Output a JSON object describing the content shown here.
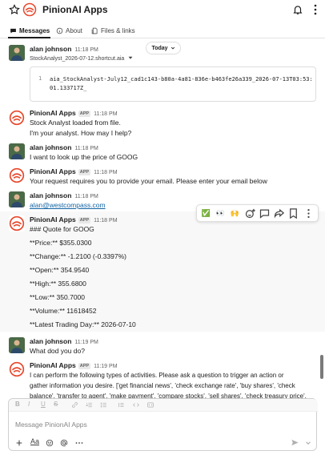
{
  "app": {
    "title": "PinionAI Apps"
  },
  "tabs": [
    {
      "label": "Messages"
    },
    {
      "label": "About"
    },
    {
      "label": "Files & links"
    }
  ],
  "date_pill": "Today",
  "messages": [
    {
      "sender": "alan johnson",
      "time": "11:18 PM",
      "file_name": "StockAnalyst_2026-07-12.shortcut.aia",
      "code_line_no": "1",
      "code": "aia_StockAnalyst-July12_cad1c143-b80a-4a81-836e-b463fe26a339_2026-07-13T03:53:01.133717Z_"
    },
    {
      "sender": "PinionAI Apps",
      "badge": "APP",
      "time": "11:18 PM",
      "lines": [
        "Stock Analyst loaded from file.",
        "I'm your analyst. How may I help?"
      ]
    },
    {
      "sender": "alan johnson",
      "time": "11:18 PM",
      "lines": [
        "I want to look up the price of GOOG"
      ]
    },
    {
      "sender": "PinionAI Apps",
      "badge": "APP",
      "time": "11:18 PM",
      "lines": [
        "Your request requires you to provide your email. Please enter your email below"
      ]
    },
    {
      "sender": "alan johnson",
      "time": "11:18 PM",
      "link": "alan@westcompass.com"
    },
    {
      "sender": "PinionAI Apps",
      "badge": "APP",
      "time": "11:18 PM",
      "lines": [
        "### Quote for GOOG",
        "**Price:** $355.0300",
        "**Change:** -1.2100 (-0.3397%)",
        "**Open:** 354.9540",
        "**High:** 355.6800",
        "**Low:** 350.7000",
        "**Volume:** 11618452",
        "**Latest Trading Day:** 2026-07-10"
      ]
    },
    {
      "sender": "alan johnson",
      "time": "11:19 PM",
      "lines": [
        "What dod you do?"
      ]
    },
    {
      "sender": "PinionAI Apps",
      "badge": "APP",
      "time": "11:19 PM",
      "lines": [
        "I can perform the following types of activities.  Please ask a question to trigger an action or",
        "gather information you desire. ['get financial news', 'check exchange rate', 'buy shares', 'check",
        "balance', 'transfer to agent', 'make payment', 'compare stocks', 'sell shares', 'check treasury price',"
      ]
    }
  ],
  "toolbar": {
    "icons": [
      "check-mark-icon",
      "eyes-icon",
      "raised-hands-icon",
      "add-reaction-icon",
      "reply-in-thread-icon",
      "share-icon",
      "bookmark-icon",
      "more-actions-icon"
    ],
    "emoji": [
      "✅",
      "👀",
      "🙌"
    ]
  },
  "composer": {
    "placeholder": "Message PinionAI Apps",
    "format_labels": [
      "B",
      "I",
      "U",
      "S"
    ],
    "text_format": "Aa"
  }
}
